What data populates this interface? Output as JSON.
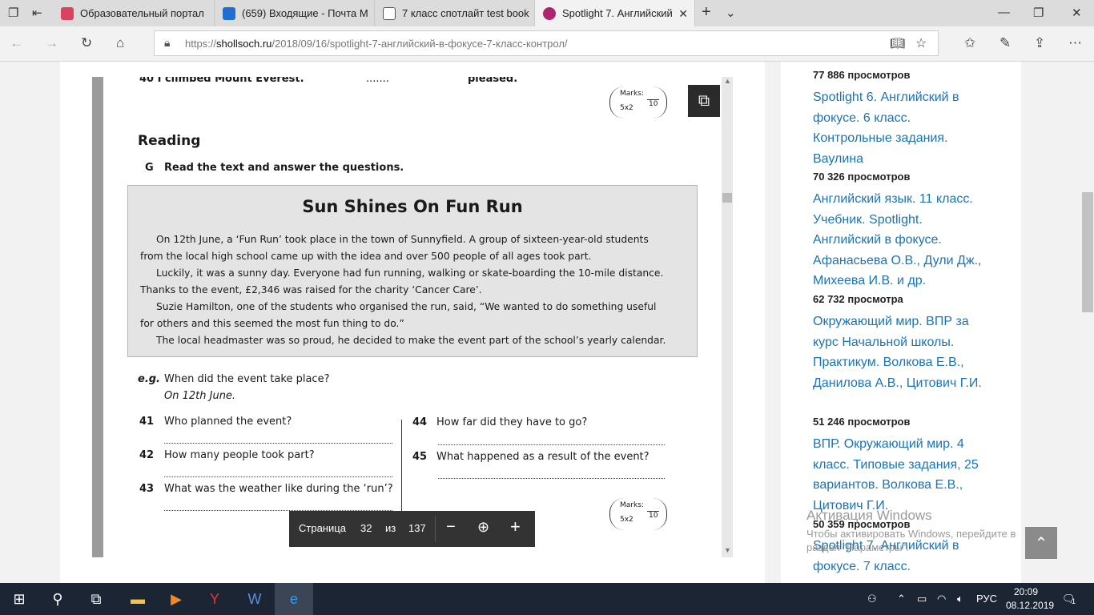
{
  "tabs": [
    {
      "label": "Образовательный портал"
    },
    {
      "label": "(659) Входящие - Почта М"
    },
    {
      "label": "7 класс спотлайт test book"
    },
    {
      "label": "Spotlight 7. Английский"
    }
  ],
  "address": {
    "prefix": "https://",
    "domain": "shollsoch.ru",
    "path": "/2018/09/16/spotlight-7-английский-в-фокусе-7-класс-контрол/"
  },
  "doc": {
    "q40": "40   I climbed Mount Everest.",
    "q40_dots": ".......",
    "q40_end": "pleased.",
    "marks_label": "Marks:",
    "marks_mult": "5x2",
    "marks_total": "10",
    "section": "Reading",
    "task_letter": "G",
    "task_text": "Read the text and answer the questions.",
    "article_title": "Sun Shines On Fun Run",
    "p1a": "On 12th June, a ‘Fun Run’ took place in the town of Sunnyfield. A group of sixteen-year-old students",
    "p1b": "from the local high school came up with the idea and over 500 people of all ages took part.",
    "p2a": "Luckily, it was a sunny day. Everyone had fun running, walking or skate-boarding the 10-mile distance.",
    "p2b": "Thanks to the event, £2,346 was raised for the charity ‘Cancer Care’.",
    "p3a": "Suzie Hamilton, one of the students who organised the run, said, “We wanted to do something useful",
    "p3b": "for others and this seemed the most fun thing to do.”",
    "p4": "The local headmaster was so proud, he decided to make the event part of the school’s yearly calendar.",
    "eg_label": "e.g.",
    "eg_q": "When did the event take place?",
    "eg_a": "On 12th June.",
    "q41n": "41",
    "q41": "Who planned the event?",
    "q42n": "42",
    "q42": "How many people took part?",
    "q43n": "43",
    "q43": "What was the weather like during the ‘run’?",
    "q44n": "44",
    "q44": "How far did they have to go?",
    "q45n": "45",
    "q45": "What happened as a result of the event?"
  },
  "pager": {
    "label": "Страница",
    "current": "32",
    "of": "из",
    "total": "137"
  },
  "sidebar": {
    "items": [
      {
        "count": "77 886 просмотров"
      },
      {
        "link": "Spotlight 6. Английский в фокусе. 6 класс. Контрольные задания. Ваулина",
        "count": "70 326 просмотров"
      },
      {
        "link": "Английский язык. 11 класс. Учебник. Spotlight. Английский в фокусе. Афанасьева О.В., Дули Дж., Михеева И.В. и др.",
        "count": "62 732 просмотра"
      },
      {
        "link": "Окружающий мир. ВПР за курс Начальной школы. Практикум. Волкова Е.В., Данилова А.В., Цитович Г.И.",
        "count": "51 246 просмотров"
      },
      {
        "link": "ВПР. Окружающий мир. 4 класс. Типовые задания, 25 вариантов. Волкова Е.В., Цитович Г.И.",
        "count": "50 359 просмотров"
      },
      {
        "link": "Spotlight 7. Английский в фокусе. 7 класс."
      }
    ]
  },
  "watermark": {
    "title": "Активация Windows",
    "sub": "Чтобы активировать Windows, перейдите в раздел \"Параметры\"."
  },
  "taskbar": {
    "lang": "РУС",
    "time": "20:09",
    "date": "08.12.2019",
    "notif": "1"
  }
}
